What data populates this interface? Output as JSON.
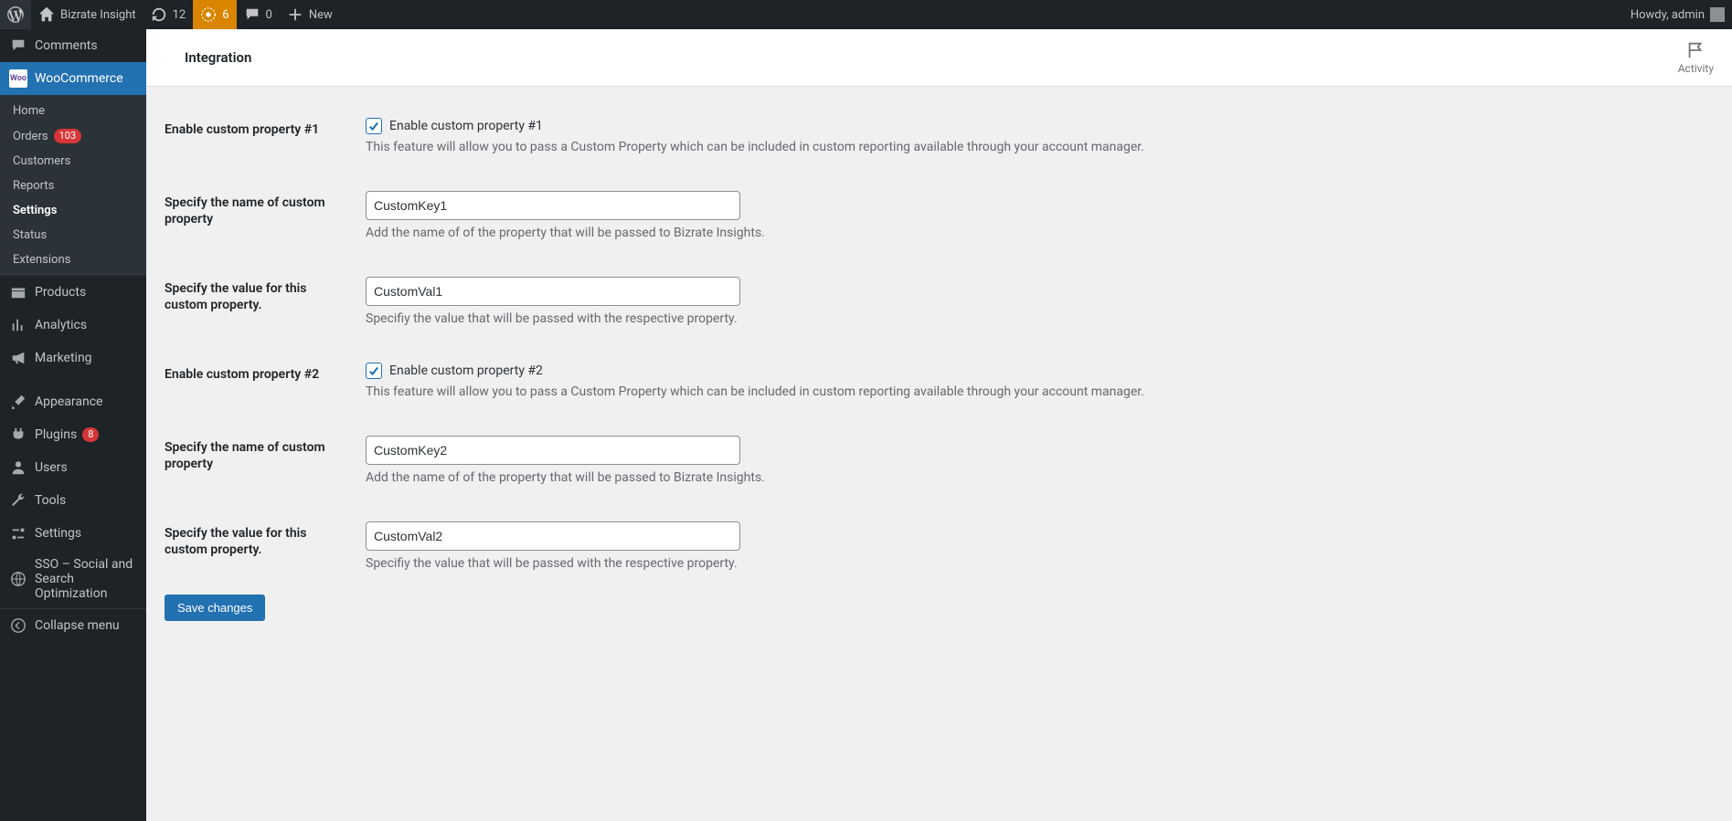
{
  "adminbar": {
    "site_title": "Bizrate Insight",
    "updates_count": "12",
    "notices_count": "6",
    "comments_count": "0",
    "new_label": "New",
    "howdy": "Howdy, admin"
  },
  "sidebar": {
    "comments": "Comments",
    "woocommerce": "WooCommerce",
    "woo_badge": "Woo",
    "submenu": {
      "home": "Home",
      "orders": "Orders",
      "orders_badge": "103",
      "customers": "Customers",
      "reports": "Reports",
      "settings": "Settings",
      "status": "Status",
      "extensions": "Extensions"
    },
    "products": "Products",
    "analytics": "Analytics",
    "marketing": "Marketing",
    "appearance": "Appearance",
    "plugins": "Plugins",
    "plugins_badge": "8",
    "users": "Users",
    "tools": "Tools",
    "settings": "Settings",
    "sso": "SSO – Social and Search Optimization",
    "collapse": "Collapse menu"
  },
  "subheader": {
    "title": "Integration",
    "activity": "Activity"
  },
  "form": {
    "cp1": {
      "row_label": "Enable custom property #1",
      "check_label": "Enable custom property #1",
      "desc": "This feature will allow you to pass a Custom Property which can be included in custom reporting available through your account manager."
    },
    "name1": {
      "row_label": "Specify the name of custom property",
      "value": "CustomKey1",
      "desc": "Add the name of of the property that will be passed to Bizrate Insights."
    },
    "val1": {
      "row_label": "Specify the value for this custom property.",
      "value": "CustomVal1",
      "desc": "Specifiy the value that will be passed with the respective property."
    },
    "cp2": {
      "row_label": "Enable custom property #2",
      "check_label": "Enable custom property #2",
      "desc": "This feature will allow you to pass a Custom Property which can be included in custom reporting available through your account manager."
    },
    "name2": {
      "row_label": "Specify the name of custom property",
      "value": "CustomKey2",
      "desc": "Add the name of of the property that will be passed to Bizrate Insights."
    },
    "val2": {
      "row_label": "Specify the value for this custom property.",
      "value": "CustomVal2",
      "desc": "Specifiy the value that will be passed with the respective property."
    },
    "save": "Save changes"
  }
}
